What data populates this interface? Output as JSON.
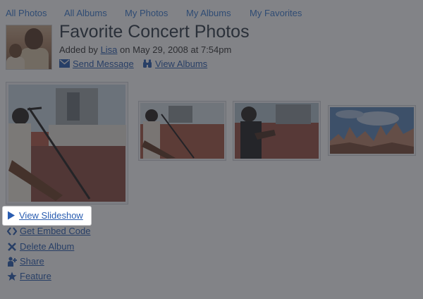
{
  "nav": {
    "items": [
      "All Photos",
      "All Albums",
      "My Photos",
      "My Albums",
      "My Favorites"
    ]
  },
  "album": {
    "title": "Favorite Concert Photos",
    "added_by_prefix": "Added by",
    "author": "Lisa",
    "date_text": "on May 29, 2008 at 7:54pm",
    "send_message": "Send Message",
    "view_albums": "View Albums"
  },
  "links": {
    "view_slideshow": "View Slideshow",
    "get_embed_code": "Get Embed Code",
    "delete_album": "Delete Album",
    "share": "Share",
    "feature": "Feature"
  },
  "icons": {
    "send_message": "envelope-icon",
    "view_albums": "binoculars-icon",
    "view_slideshow": "play-icon",
    "get_embed_code": "code-icon",
    "delete_album": "x-icon",
    "share": "share-person-icon",
    "feature": "star-icon"
  },
  "colors": {
    "link": "#2a5db0",
    "nav_link": "#3a7bd0",
    "title": "#2f3a45",
    "overlay": "#282a30"
  }
}
